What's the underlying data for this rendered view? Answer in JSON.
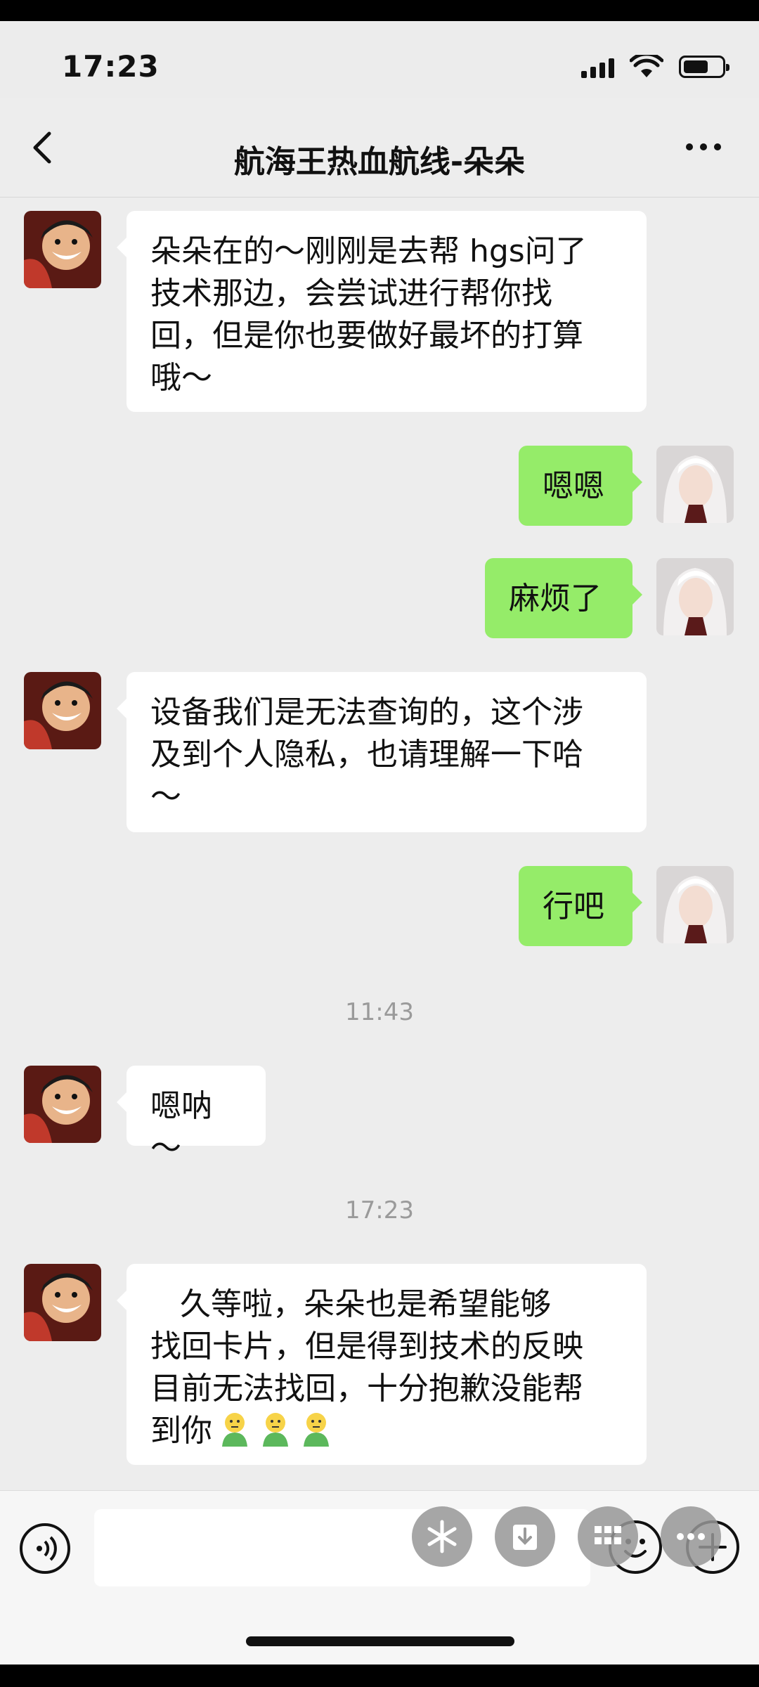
{
  "status_bar": {
    "time": "17:23"
  },
  "header": {
    "title": "航海王热血航线-朵朵"
  },
  "messages": [
    {
      "text": "朵朵在的～刚刚是去帮 hgs问了\n技术那边，会尝试进行帮你找\n回，但是你也要做好最坏的打算\n哦～"
    },
    {
      "text": "嗯嗯"
    },
    {
      "text": "麻烦了"
    },
    {
      "text": "设备我们是无法查询的，这个涉\n及到个人隐私，也请理解一下哈\n～"
    },
    {
      "text": "行吧"
    },
    {
      "text": "嗯呐～"
    },
    {
      "text": "   久等啦，朵朵也是希望能够\n找回卡片，但是得到技术的反映\n目前无法找回，十分抱歉没能帮\n到你"
    }
  ],
  "timestamps": [
    "11:43",
    "17:23"
  ],
  "icons": {
    "back": "chevron-left-icon",
    "more": "more-icon",
    "voice": "voice-icon",
    "emoji": "smiley-icon",
    "plus": "plus-icon"
  },
  "colors": {
    "outgoing_bubble": "#95ec69",
    "incoming_bubble": "#ffffff",
    "background": "#ededed"
  }
}
